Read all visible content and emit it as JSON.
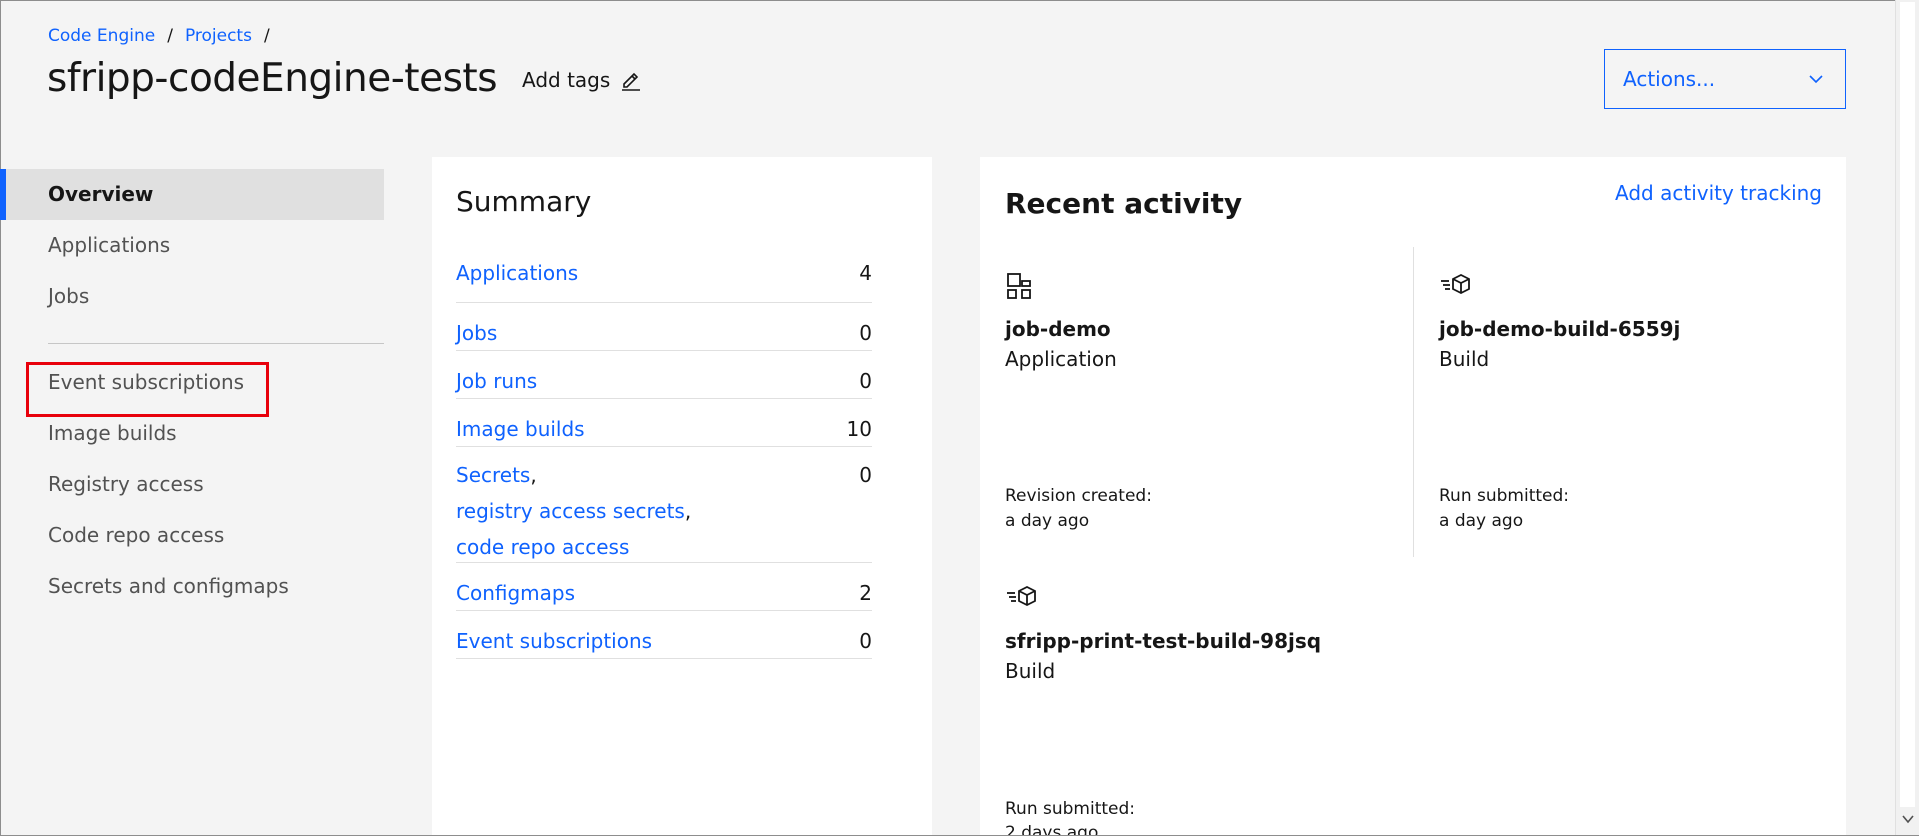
{
  "breadcrumb": {
    "items": [
      "Code Engine",
      "Projects"
    ],
    "separator": "/"
  },
  "header": {
    "title": "sfripp-codeEngine-tests",
    "add_tags_label": "Add tags",
    "actions_label": "Actions..."
  },
  "sidebar": {
    "items": [
      {
        "label": "Overview",
        "active": true
      },
      {
        "label": "Applications"
      },
      {
        "label": "Jobs"
      },
      {
        "label": "Event subscriptions",
        "highlighted": true
      },
      {
        "label": "Image builds"
      },
      {
        "label": "Registry access"
      },
      {
        "label": "Code repo access"
      },
      {
        "label": "Secrets and configmaps"
      }
    ]
  },
  "summary": {
    "title": "Summary",
    "rows": [
      {
        "label": "Applications",
        "count": "4"
      },
      {
        "label": "Jobs",
        "count": "0"
      },
      {
        "label": "Job runs",
        "count": "0"
      },
      {
        "label": "Image builds",
        "count": "10"
      },
      {
        "labels": [
          "Secrets",
          "registry access secrets",
          "code repo access"
        ],
        "count": "0"
      },
      {
        "label": "Configmaps",
        "count": "2"
      },
      {
        "label": "Event subscriptions",
        "count": "0"
      }
    ]
  },
  "activity": {
    "title": "Recent activity",
    "add_tracking_label": "Add activity tracking",
    "items": [
      {
        "name": "job-demo",
        "type": "Application",
        "icon": "application-icon",
        "meta_label": "Revision created:",
        "meta_value": "a day ago"
      },
      {
        "name": "job-demo-build-6559j",
        "type": "Build",
        "icon": "build-icon",
        "meta_label": "Run submitted:",
        "meta_value": "a day ago"
      },
      {
        "name": "sfripp-print-test-build-98jsq",
        "type": "Build",
        "icon": "build-icon",
        "meta_label": "Run submitted:",
        "meta_value": "2 days ago"
      }
    ]
  },
  "colors": {
    "link": "#0f62fe",
    "highlight": "#e8000b",
    "background": "#f4f4f4"
  }
}
